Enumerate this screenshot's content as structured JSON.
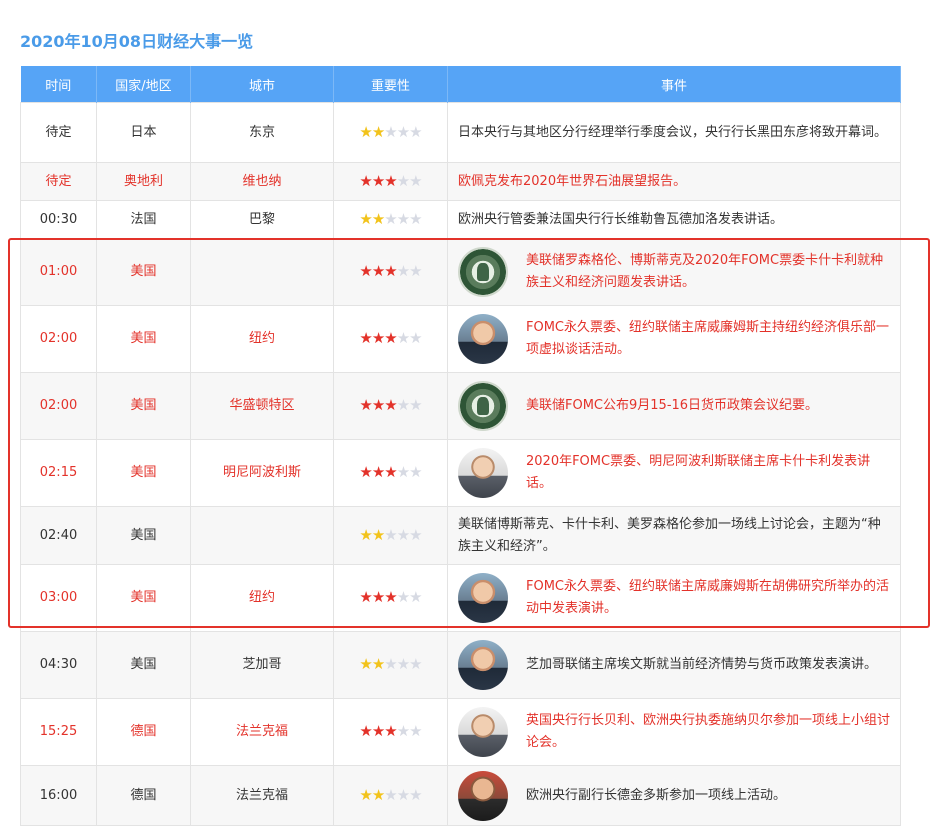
{
  "page": {
    "title": "2020年10月08日财经大事一览"
  },
  "headers": [
    "时间",
    "国家/地区",
    "城市",
    "重要性",
    "事件"
  ],
  "rows": [
    {
      "time": "待定",
      "country": "日本",
      "city": "东京",
      "stars": 2,
      "event": "日本央行与其地区分行经理举行季度会议，央行行长黑田东彦将致开幕词。",
      "avatar": ""
    },
    {
      "time": "待定",
      "country": "奥地利",
      "city": "维也纳",
      "stars": 3,
      "event": "欧佩克发布2020年世界石油展望报告。",
      "avatar": ""
    },
    {
      "time": "00:30",
      "country": "法国",
      "city": "巴黎",
      "stars": 2,
      "event": "欧洲央行管委兼法国央行行长维勒鲁瓦德加洛发表讲话。",
      "avatar": ""
    },
    {
      "time": "01:00",
      "country": "美国",
      "city": "",
      "stars": 3,
      "event": "美联储罗森格伦、博斯蒂克及2020年FOMC票委卡什卡利就种族主义和经济问题发表讲话。",
      "avatar": "fed-seal"
    },
    {
      "time": "02:00",
      "country": "美国",
      "city": "纽约",
      "stars": 3,
      "event": "FOMC永久票委、纽约联储主席威廉姆斯主持纽约经济俱乐部一项虚拟谈话活动。",
      "avatar": "williams-photo"
    },
    {
      "time": "02:00",
      "country": "美国",
      "city": "华盛顿特区",
      "stars": 3,
      "event": "美联储FOMC公布9月15-16日货币政策会议纪要。",
      "avatar": "fed-seal"
    },
    {
      "time": "02:15",
      "country": "美国",
      "city": "明尼阿波利斯",
      "stars": 3,
      "event": "2020年FOMC票委、明尼阿波利斯联储主席卡什卡利发表讲话。",
      "avatar": "kashkari-photo"
    },
    {
      "time": "02:40",
      "country": "美国",
      "city": "",
      "stars": 2,
      "event": "美联储博斯蒂克、卡什卡利、美罗森格伦参加一场线上讨论会，主题为“种族主义和经济”。",
      "avatar": ""
    },
    {
      "time": "03:00",
      "country": "美国",
      "city": "纽约",
      "stars": 3,
      "event": "FOMC永久票委、纽约联储主席威廉姆斯在胡佛研究所举办的活动中发表演讲。",
      "avatar": "williams-photo"
    },
    {
      "time": "04:30",
      "country": "美国",
      "city": "芝加哥",
      "stars": 2,
      "event": "芝加哥联储主席埃文斯就当前经济情势与货币政策发表演讲。",
      "avatar": "evans-photo"
    },
    {
      "time": "15:25",
      "country": "德国",
      "city": "法兰克福",
      "stars": 3,
      "event": "英国央行行长贝利、欧洲央行执委施纳贝尔参加一项线上小组讨论会。",
      "avatar": "bailey-photo"
    },
    {
      "time": "16:00",
      "country": "德国",
      "city": "法兰克福",
      "stars": 2,
      "event": "欧洲央行副行长德金多斯参加一项线上活动。",
      "avatar": "guindos-photo"
    }
  ],
  "colors": {
    "header_bg": "#56a4f6",
    "title": "#4a9be8",
    "important_text": "#e3322a",
    "star_gold": "#f2c31b",
    "star_red": "#e3322a",
    "star_off": "#d7dae3",
    "highlight_box": "#e3322a"
  }
}
